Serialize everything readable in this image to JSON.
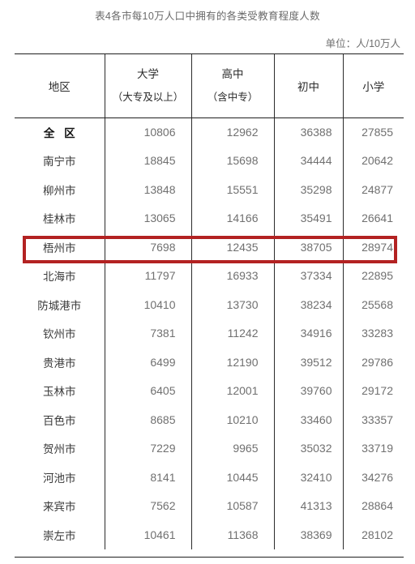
{
  "document": {
    "title": "表4各市每10万人口中拥有的各类受教育程度人数",
    "unit_note": "单位：人/10万人"
  },
  "table": {
    "columns": [
      {
        "key": "region",
        "main": "地区",
        "sub": ""
      },
      {
        "key": "university",
        "main": "大学",
        "sub": "（大专及以上）"
      },
      {
        "key": "high_school",
        "main": "高中",
        "sub": "（含中专）"
      },
      {
        "key": "junior_high",
        "main": "初中",
        "sub": ""
      },
      {
        "key": "primary",
        "main": "小学",
        "sub": ""
      }
    ],
    "highlight": {
      "row_label": "梧州市",
      "color": "#b32222"
    },
    "rows": [
      {
        "region": "全 区",
        "university": "10806",
        "high_school": "12962",
        "junior_high": "36388",
        "primary": "27855",
        "emphasis": "total",
        "highlighted": false
      },
      {
        "region": "南宁市",
        "university": "18845",
        "high_school": "15698",
        "junior_high": "34444",
        "primary": "20642",
        "emphasis": "",
        "highlighted": false
      },
      {
        "region": "柳州市",
        "university": "13848",
        "high_school": "15551",
        "junior_high": "35298",
        "primary": "24877",
        "emphasis": "",
        "highlighted": false
      },
      {
        "region": "桂林市",
        "university": "13065",
        "high_school": "14166",
        "junior_high": "35491",
        "primary": "26641",
        "emphasis": "",
        "highlighted": false
      },
      {
        "region": "梧州市",
        "university": "7698",
        "high_school": "12435",
        "junior_high": "38705",
        "primary": "28974",
        "emphasis": "",
        "highlighted": true
      },
      {
        "region": "北海市",
        "university": "11797",
        "high_school": "16933",
        "junior_high": "37334",
        "primary": "22895",
        "emphasis": "",
        "highlighted": false
      },
      {
        "region": "防城港市",
        "university": "10410",
        "high_school": "13730",
        "junior_high": "38234",
        "primary": "25568",
        "emphasis": "",
        "highlighted": false
      },
      {
        "region": "钦州市",
        "university": "7381",
        "high_school": "11242",
        "junior_high": "34916",
        "primary": "33283",
        "emphasis": "",
        "highlighted": false
      },
      {
        "region": "贵港市",
        "university": "6499",
        "high_school": "12190",
        "junior_high": "39512",
        "primary": "29786",
        "emphasis": "",
        "highlighted": false
      },
      {
        "region": "玉林市",
        "university": "6405",
        "high_school": "12001",
        "junior_high": "39760",
        "primary": "29172",
        "emphasis": "",
        "highlighted": false
      },
      {
        "region": "百色市",
        "university": "8685",
        "high_school": "10210",
        "junior_high": "33460",
        "primary": "33357",
        "emphasis": "",
        "highlighted": false
      },
      {
        "region": "贺州市",
        "university": "7229",
        "high_school": "9965",
        "junior_high": "35032",
        "primary": "33719",
        "emphasis": "",
        "highlighted": false
      },
      {
        "region": "河池市",
        "university": "8141",
        "high_school": "10445",
        "junior_high": "32410",
        "primary": "34276",
        "emphasis": "",
        "highlighted": false
      },
      {
        "region": "来宾市",
        "university": "7562",
        "high_school": "10587",
        "junior_high": "41313",
        "primary": "28864",
        "emphasis": "",
        "highlighted": false
      },
      {
        "region": "崇左市",
        "university": "10461",
        "high_school": "11368",
        "junior_high": "38369",
        "primary": "28102",
        "emphasis": "",
        "highlighted": false
      }
    ]
  }
}
